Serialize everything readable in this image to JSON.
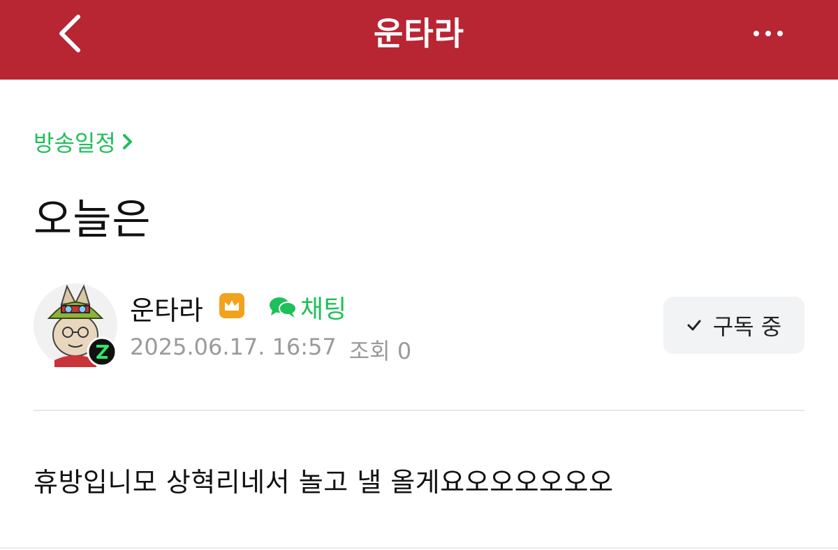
{
  "header": {
    "title": "운타라",
    "back_icon": "chevron-left-icon",
    "more_icon": "more-horizontal-icon",
    "background_color": "#b82533"
  },
  "post": {
    "category": "방송일정",
    "title": "오늘은",
    "author": {
      "name": "운타라",
      "badge_icon": "crown-icon",
      "chat_label": "채팅",
      "chat_icon": "chat-bubbles-icon"
    },
    "date": "2025.06.17. 16:57",
    "views_label": "조회 0",
    "subscribe_label": "구독 중",
    "body": "휴방입니모 상혁리네서 놀고 낼 올게요오오오오오오"
  },
  "colors": {
    "accent_green": "#1fbf5a",
    "badge_orange": "#f2a21d"
  }
}
